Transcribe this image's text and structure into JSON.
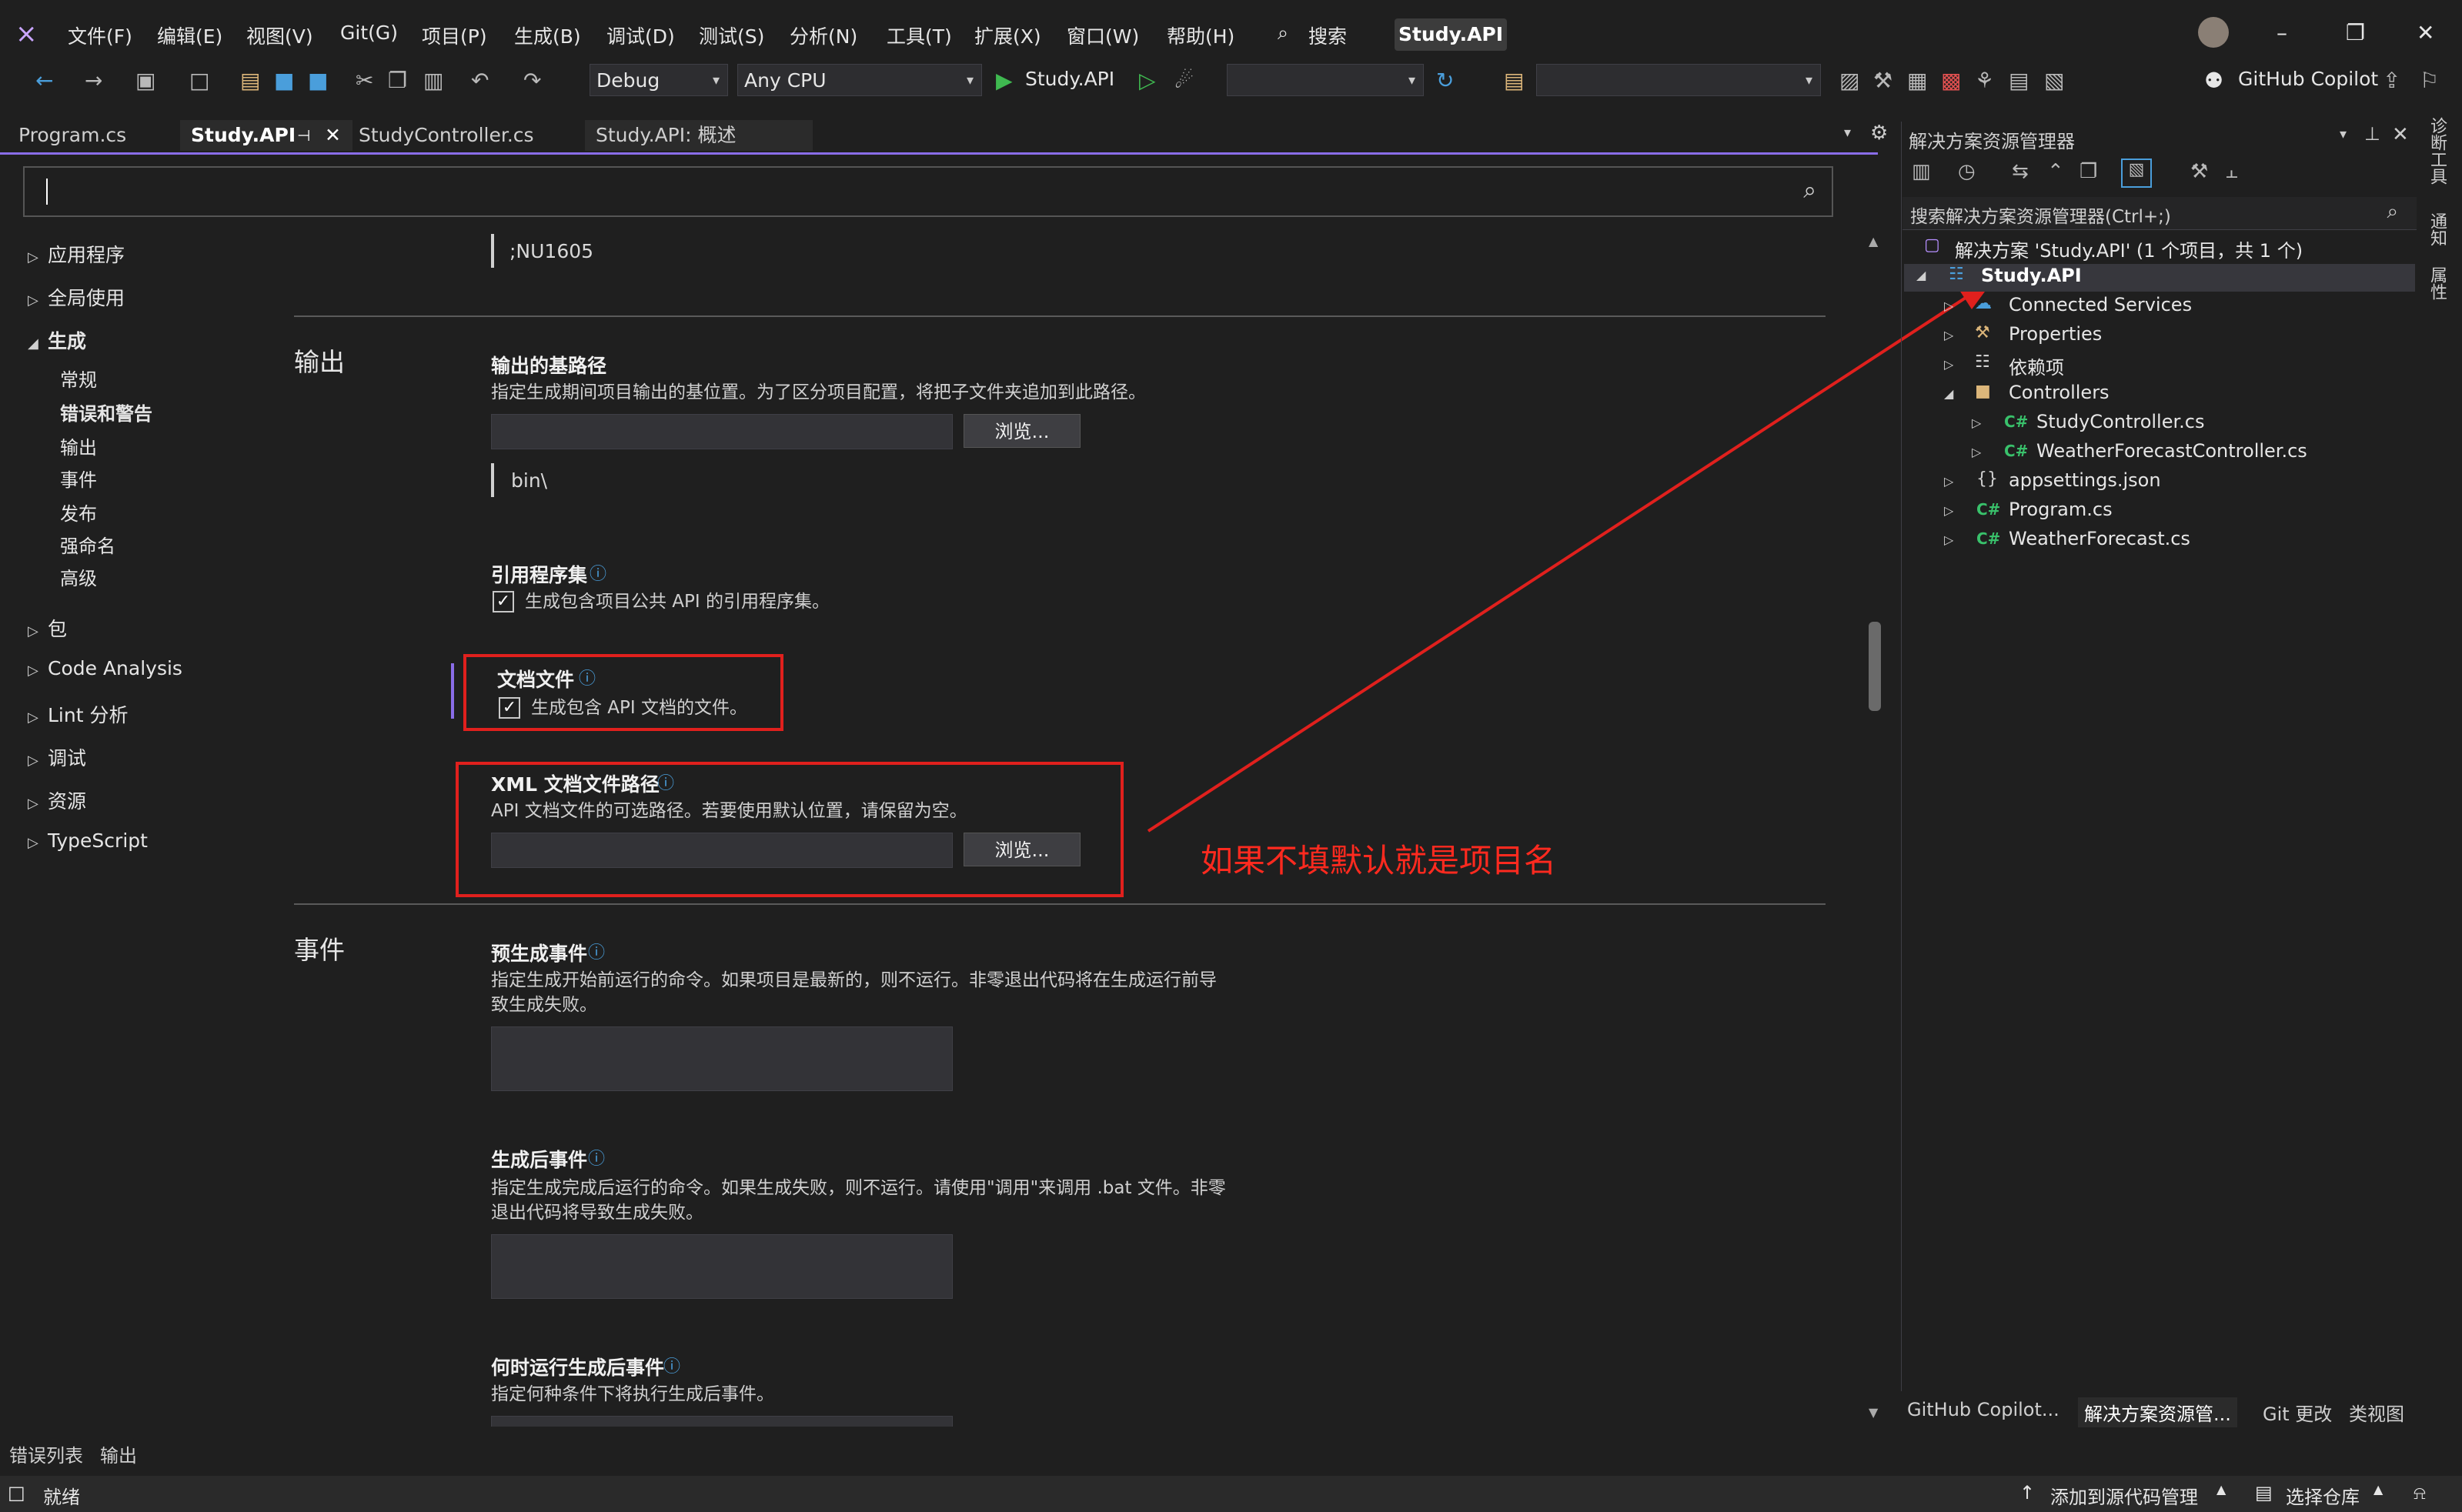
{
  "menubar": {
    "items": [
      "文件(F)",
      "编辑(E)",
      "视图(V)",
      "Git(G)",
      "项目(P)",
      "生成(B)",
      "调试(D)",
      "测试(S)",
      "分析(N)",
      "工具(T)",
      "扩展(X)",
      "窗口(W)",
      "帮助(H)"
    ],
    "search_label": "搜索",
    "title_badge": "Study.API"
  },
  "toolbar": {
    "config": "Debug",
    "platform": "Any CPU",
    "run_target": "Study.API",
    "copilot": "GitHub Copilot"
  },
  "tabs": [
    "Program.cs",
    "Study.API",
    "StudyController.cs",
    "Study.API: 概述"
  ],
  "nav": {
    "app": "应用程序",
    "global": "全局使用",
    "build": "生成",
    "build_sub": [
      "常规",
      "错误和警告",
      "输出",
      "事件",
      "发布",
      "强命名",
      "高级"
    ],
    "package": "包",
    "code_analysis": "Code Analysis",
    "lint": "Lint 分析",
    "debug": "调试",
    "resources": "资源",
    "typescript": "TypeScript"
  },
  "content": {
    "top_value": ";NU1605",
    "output_section": "输出",
    "base_path_label": "输出的基路径",
    "base_path_desc": "指定生成期间项目输出的基位置。为了区分项目配置，将把子文件夹追加到此路径。",
    "browse": "浏览...",
    "base_path_value": "bin\\",
    "ref_asm_label": "引用程序集",
    "ref_asm_check": "生成包含项目公共 API 的引用程序集。",
    "doc_file_label": "文档文件",
    "doc_file_check": "生成包含 API 文档的文件。",
    "xml_path_label": "XML 文档文件路径",
    "xml_path_desc": "API 文档文件的可选路径。若要使用默认位置，请保留为空。",
    "annotation": "如果不填默认就是项目名",
    "events_section": "事件",
    "prebuild_label": "预生成事件",
    "prebuild_desc1": "指定生成开始前运行的命令。如果项目是最新的，则不运行。非零退出代码将在生成运行前导",
    "prebuild_desc2": "致生成失败。",
    "postbuild_label": "生成后事件",
    "postbuild_desc1": "指定生成完成后运行的命令。如果生成失败，则不运行。请使用\"调用\"来调用 .bat 文件。非零",
    "postbuild_desc2": "退出代码将导致生成失败。",
    "when_label": "何时运行生成后事件",
    "when_desc": "指定何种条件下将执行生成后事件。"
  },
  "solution_explorer": {
    "title": "解决方案资源管理器",
    "search_placeholder": "搜索解决方案资源管理器(Ctrl+;)",
    "solution": "解决方案 'Study.API' (1 个项目，共 1 个)",
    "project": "Study.API",
    "items": {
      "connected": "Connected Services",
      "properties": "Properties",
      "deps": "依赖项",
      "controllers": "Controllers",
      "study_ctrl": "StudyController.cs",
      "weather_ctrl": "WeatherForecastController.cs",
      "appsettings": "appsettings.json",
      "program": "Program.cs",
      "weather": "WeatherForecast.cs"
    },
    "cs_badge": "C#",
    "bottom_tabs": [
      "GitHub Copilot...",
      "解决方案资源管...",
      "Git 更改",
      "类视图"
    ]
  },
  "right_strip": [
    "诊断工具",
    "通知",
    "属性"
  ],
  "bottom_tabs": [
    "错误列表",
    "输出"
  ],
  "status": {
    "ready": "就绪",
    "source_control": "添加到源代码管理",
    "repo": "选择仓库"
  },
  "colors": {
    "accent": "#8a6de8",
    "annotation": "#e0201d"
  }
}
